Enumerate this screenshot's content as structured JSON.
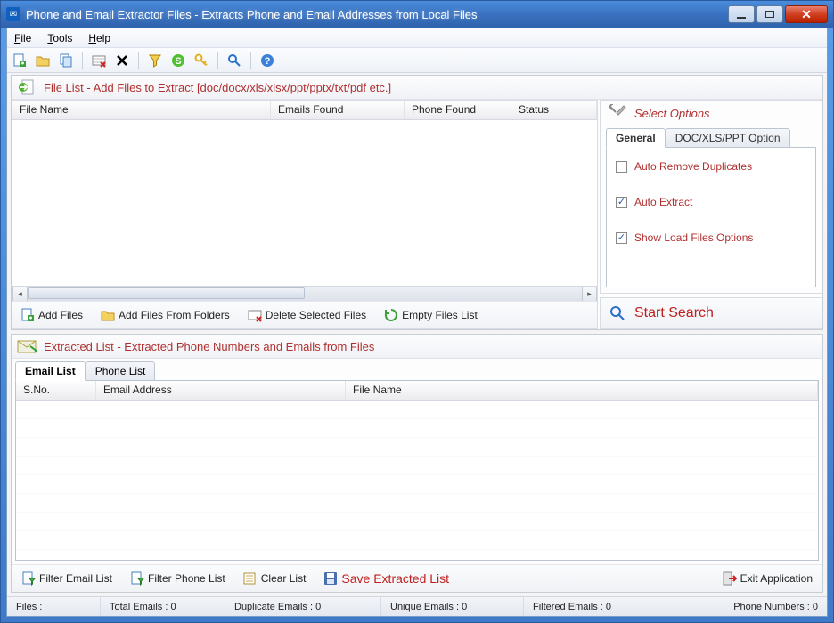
{
  "window": {
    "title": "Phone and Email Extractor Files  -  Extracts Phone and Email Addresses from Local Files"
  },
  "menubar": {
    "file": "File",
    "tools": "Tools",
    "help": "Help"
  },
  "filelist_panel": {
    "title": "File List - Add Files to Extract  [doc/docx/xls/xlsx/ppt/pptx/txt/pdf etc.]",
    "columns": {
      "filename": "File Name",
      "emails_found": "Emails Found",
      "phone_found": "Phone Found",
      "status": "Status"
    },
    "actions": {
      "add_files": "Add Files",
      "add_folders": "Add Files From Folders",
      "delete_selected": "Delete Selected Files",
      "empty_list": "Empty Files List"
    }
  },
  "options": {
    "title": "Select Options",
    "tab_general": "General",
    "tab_doc": "DOC/XLS/PPT Option",
    "auto_remove": {
      "label": "Auto Remove Duplicates",
      "checked": false
    },
    "auto_extract": {
      "label": "Auto Extract",
      "checked": true
    },
    "show_load": {
      "label": "Show Load Files Options",
      "checked": true
    }
  },
  "search_label": "Start Search",
  "extracted_panel": {
    "title": "Extracted List - Extracted Phone Numbers and Emails from Files",
    "tab_email": "Email List",
    "tab_phone": "Phone List",
    "columns": {
      "sno": "S.No.",
      "email": "Email Address",
      "filename": "File Name"
    }
  },
  "bottom_actions": {
    "filter_email": "Filter Email List",
    "filter_phone": "Filter Phone List",
    "clear": "Clear List",
    "save": "Save Extracted List",
    "exit": "Exit Application"
  },
  "statusbar": {
    "files": "Files :",
    "total_emails": "Total Emails :  0",
    "duplicate_emails": "Duplicate Emails :   0",
    "unique_emails": "Unique Emails :   0",
    "filtered_emails": "Filtered Emails :  0",
    "phone_numbers": "Phone Numbers :  0"
  }
}
